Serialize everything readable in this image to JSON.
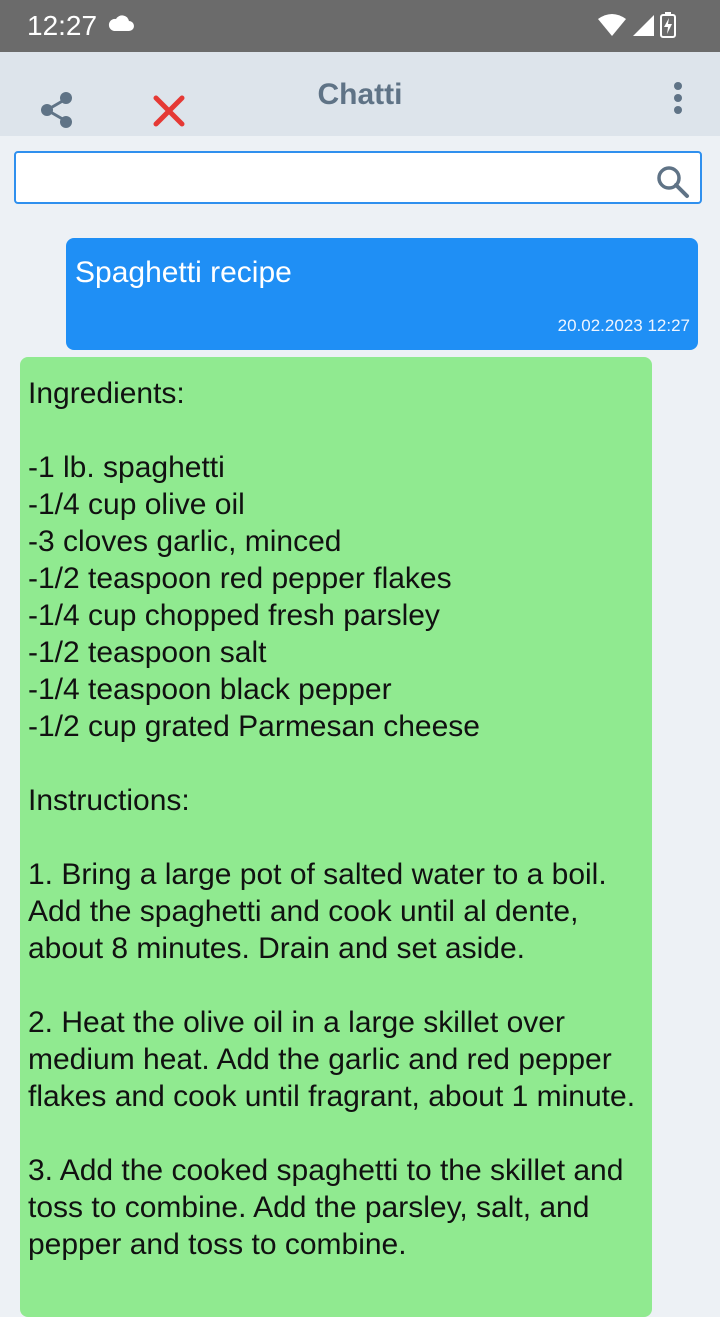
{
  "status_bar": {
    "time": "12:27",
    "icons": [
      "cloud-icon",
      "wifi-icon",
      "signal-icon",
      "battery-charging-icon"
    ]
  },
  "app_bar": {
    "title": "Chatti",
    "icons": [
      "share-icon",
      "close-icon",
      "more-vert-icon"
    ]
  },
  "search": {
    "value": "",
    "placeholder": ""
  },
  "colors": {
    "user_bubble": "#1f8ff5",
    "bot_bubble": "#90ea90",
    "close_icon": "#e53935",
    "search_border": "#2f90ee"
  },
  "messages": [
    {
      "sender": "user",
      "text": "Spaghetti recipe",
      "time": "20.02.2023 12:27"
    },
    {
      "sender": "bot",
      "text": "Ingredients:\n\n-1 lb. spaghetti\n-1/4 cup olive oil\n-3 cloves garlic, minced\n-1/2 teaspoon red pepper flakes\n-1/4 cup chopped fresh parsley\n-1/2 teaspoon salt\n-1/4 teaspoon black pepper\n-1/2 cup grated Parmesan cheese\n\nInstructions:\n\n1. Bring a large pot of salted water to a boil. Add the spaghetti and cook until al dente, about 8 minutes. Drain and set aside.\n\n2. Heat the olive oil in a large skillet over medium heat. Add the garlic and red pepper flakes and cook until fragrant, about 1 minute.\n\n3. Add the cooked spaghetti to the skillet and toss to combine. Add the parsley, salt, and pepper and toss to combine."
    }
  ]
}
